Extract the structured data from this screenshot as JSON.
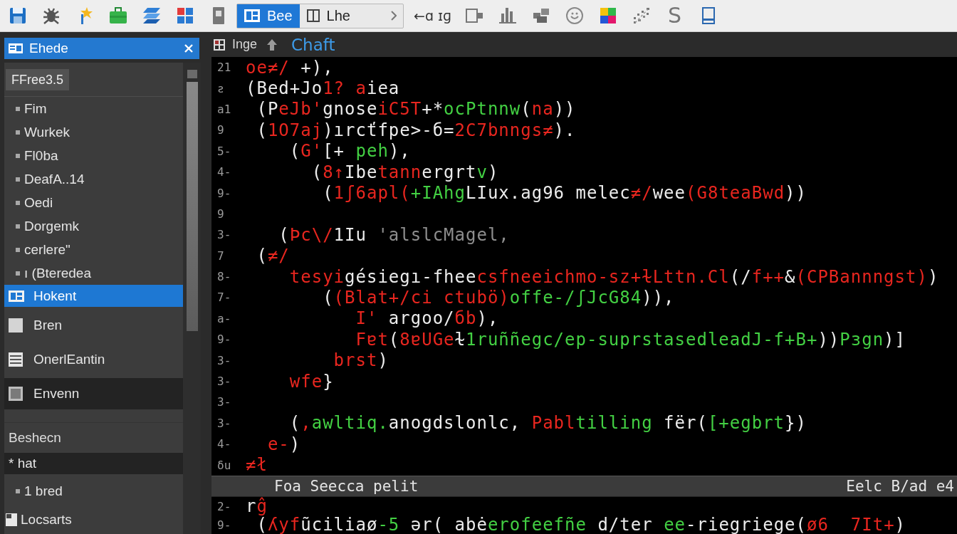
{
  "toolbar": {
    "view_tabs": [
      {
        "label": "Bee",
        "selected": true
      },
      {
        "label": "Lhe",
        "selected": false
      }
    ],
    "nav_button": "←ɑ ɪɡ",
    "letter_button": "S"
  },
  "sidebar": {
    "title": "Ehede",
    "chip": "FFree3.5",
    "items": [
      {
        "kind": "bullet",
        "label": "Fim",
        "selected": false,
        "highlighted": false
      },
      {
        "kind": "bullet",
        "label": "Wurkek",
        "selected": false,
        "highlighted": false
      },
      {
        "kind": "bullet",
        "label": "Fl0ba",
        "selected": false,
        "highlighted": false
      },
      {
        "kind": "bullet",
        "label": "DeafA..14",
        "selected": false,
        "highlighted": false
      },
      {
        "kind": "bullet",
        "label": "Oedi",
        "selected": false,
        "highlighted": false
      },
      {
        "kind": "bullet",
        "label": "Dorgemk",
        "selected": false,
        "highlighted": false
      },
      {
        "kind": "bullet",
        "label": "cerlere\"",
        "selected": false,
        "highlighted": false
      },
      {
        "kind": "bullet",
        "label": "ı (Bteredea",
        "selected": false,
        "highlighted": false
      },
      {
        "kind": "tile",
        "label": "Hokent",
        "selected": true,
        "highlighted": false
      },
      {
        "kind": "square",
        "label": "Bren",
        "selected": false,
        "highlighted": false
      },
      {
        "kind": "lines",
        "label": "OnerlEantin",
        "selected": false,
        "highlighted": false
      },
      {
        "kind": "box",
        "label": "Envenn",
        "selected": false,
        "highlighted": true
      }
    ],
    "section": {
      "title": "Beshecn",
      "items": [
        {
          "kind": "text",
          "label": "* hat",
          "selected": false,
          "highlighted": true
        },
        {
          "kind": "bullet",
          "label": "1 bred",
          "selected": false,
          "highlighted": false
        },
        {
          "kind": "doc",
          "label": "Locsarts",
          "selected": false,
          "highlighted": false
        }
      ]
    }
  },
  "editor": {
    "tab": "Inge",
    "title": "Chaft",
    "lines": [
      {
        "number": "21",
        "segments": [
          {
            "kind": "keyword",
            "text": "oe≠/"
          },
          {
            "kind": "plain",
            "text": " +),"
          }
        ]
      },
      {
        "number": "ƨ",
        "segments": [
          {
            "kind": "plain",
            "text": "(Bed+Jo"
          },
          {
            "kind": "keyword",
            "text": "1?"
          },
          {
            "kind": "keyword",
            "text": " a"
          },
          {
            "kind": "plain",
            "text": "iea"
          }
        ]
      },
      {
        "number": "a1",
        "segments": [
          {
            "kind": "plain",
            "text": " (P"
          },
          {
            "kind": "keyword",
            "text": "eJb'"
          },
          {
            "kind": "plain",
            "text": "gnose"
          },
          {
            "kind": "keyword",
            "text": "iC5T"
          },
          {
            "kind": "plain",
            "text": "+*"
          },
          {
            "kind": "string",
            "text": "ocPtnnw"
          },
          {
            "kind": "plain",
            "text": "("
          },
          {
            "kind": "keyword",
            "text": "na"
          },
          {
            "kind": "plain",
            "text": "))"
          }
        ]
      },
      {
        "number": "9",
        "segments": [
          {
            "kind": "plain",
            "text": " ("
          },
          {
            "kind": "keyword",
            "text": "1O7aj"
          },
          {
            "kind": "plain",
            "text": ")ırcťfpe>-б="
          },
          {
            "kind": "keyword",
            "text": "2C7bnngs≠"
          },
          {
            "kind": "plain",
            "text": ")."
          }
        ]
      },
      {
        "number": "5-",
        "segments": [
          {
            "kind": "plain",
            "text": "    ("
          },
          {
            "kind": "keyword",
            "text": "G'"
          },
          {
            "kind": "plain",
            "text": "[+ "
          },
          {
            "kind": "string",
            "text": "peh"
          },
          {
            "kind": "plain",
            "text": "),"
          }
        ]
      },
      {
        "number": "4-",
        "segments": [
          {
            "kind": "plain",
            "text": "      ("
          },
          {
            "kind": "keyword",
            "text": "8↑"
          },
          {
            "kind": "plain",
            "text": "Ibe"
          },
          {
            "kind": "keyword",
            "text": "tann"
          },
          {
            "kind": "plain",
            "text": "ergrt"
          },
          {
            "kind": "string",
            "text": "v"
          },
          {
            "kind": "plain",
            "text": ")"
          }
        ]
      },
      {
        "number": "9-",
        "segments": [
          {
            "kind": "plain",
            "text": "       ("
          },
          {
            "kind": "keyword",
            "text": "1ʃ6apl("
          },
          {
            "kind": "string",
            "text": "+IAhg"
          },
          {
            "kind": "plain",
            "text": "LIux.ag96 melec"
          },
          {
            "kind": "keyword",
            "text": "≠/"
          },
          {
            "kind": "plain",
            "text": "wee"
          },
          {
            "kind": "keyword",
            "text": "(G8teaBwd"
          },
          {
            "kind": "plain",
            "text": "))"
          }
        ]
      },
      {
        "number": "9"
      },
      {
        "number": "3-",
        "segments": [
          {
            "kind": "plain",
            "text": "   ("
          },
          {
            "kind": "keyword",
            "text": "Þc\\/"
          },
          {
            "kind": "plain",
            "text": "1Iu "
          },
          {
            "kind": "comment",
            "text": "'alslcMagel,"
          }
        ]
      },
      {
        "number": "7",
        "segments": [
          {
            "kind": "plain",
            "text": " ("
          },
          {
            "kind": "keyword",
            "text": "≠/"
          }
        ]
      },
      {
        "number": "8-",
        "segments": [
          {
            "kind": "keyword",
            "text": "    tesyi"
          },
          {
            "kind": "plain",
            "text": "gésiegı-fhee"
          },
          {
            "kind": "keyword",
            "text": "csfneeichmo-sz+ɫLttn.Cl"
          },
          {
            "kind": "plain",
            "text": "(/"
          },
          {
            "kind": "keyword",
            "text": "f++"
          },
          {
            "kind": "plain",
            "text": "&"
          },
          {
            "kind": "keyword",
            "text": "(CPBannngst)"
          },
          {
            "kind": "plain",
            "text": ")"
          }
        ]
      },
      {
        "number": "7-",
        "segments": [
          {
            "kind": "plain",
            "text": "       ("
          },
          {
            "kind": "keyword",
            "text": "(Blat+/ci ctubö)"
          },
          {
            "kind": "string",
            "text": "offe-/ʃJcG84"
          },
          {
            "kind": "plain",
            "text": ")),"
          }
        ]
      },
      {
        "number": "a-",
        "segments": [
          {
            "kind": "keyword",
            "text": "          I'"
          },
          {
            "kind": "plain",
            "text": " argoo/"
          },
          {
            "kind": "keyword",
            "text": "бb"
          },
          {
            "kind": "plain",
            "text": "),"
          }
        ]
      },
      {
        "number": "9-",
        "segments": [
          {
            "kind": "keyword",
            "text": "          Fɐt"
          },
          {
            "kind": "plain",
            "text": "("
          },
          {
            "kind": "keyword",
            "text": "8ɐUGe"
          },
          {
            "kind": "plain",
            "text": "ɫ"
          },
          {
            "kind": "string",
            "text": "1ruññegc/ep-suprstasedleadJ-f+B+"
          },
          {
            "kind": "plain",
            "text": "))"
          },
          {
            "kind": "string",
            "text": "Pзgn"
          },
          {
            "kind": "plain",
            "text": ")]"
          }
        ]
      },
      {
        "number": "3-",
        "segments": [
          {
            "kind": "keyword",
            "text": "        brst"
          },
          {
            "kind": "plain",
            "text": ")"
          }
        ]
      },
      {
        "number": "3-",
        "segments": [
          {
            "kind": "keyword",
            "text": "    wfe"
          },
          {
            "kind": "plain",
            "text": "}"
          }
        ]
      },
      {
        "number": "3-"
      },
      {
        "number": "3-",
        "segments": [
          {
            "kind": "plain",
            "text": "    ("
          },
          {
            "kind": "keyword",
            "text": ","
          },
          {
            "kind": "string",
            "text": "awltiq."
          },
          {
            "kind": "plain",
            "text": "anogdslonlc, "
          },
          {
            "kind": "keyword",
            "text": "Pabl"
          },
          {
            "kind": "string",
            "text": "tilling"
          },
          {
            "kind": "plain",
            "text": " fër("
          },
          {
            "kind": "string",
            "text": "[+egbrt"
          },
          {
            "kind": "plain",
            "text": "})"
          }
        ]
      },
      {
        "number": "4-",
        "segments": [
          {
            "kind": "keyword",
            "text": "  e-"
          },
          {
            "kind": "plain",
            "text": ")"
          }
        ]
      },
      {
        "number": "δu",
        "segments": [
          {
            "kind": "keyword",
            "text": "≠ł"
          }
        ]
      }
    ],
    "find_bar": {
      "label": "Foa Seecca pelit",
      "status": "Eelc B/ad e4"
    },
    "lower_lines": [
      {
        "number": "2-",
        "segments": [
          {
            "kind": "plain",
            "text": "r"
          },
          {
            "kind": "keyword",
            "text": "ĝ"
          }
        ]
      },
      {
        "number": "9-",
        "segments": [
          {
            "kind": "plain",
            "text": " ("
          },
          {
            "kind": "keyword",
            "text": "ʎyf"
          },
          {
            "kind": "plain",
            "text": "ũciliaø"
          },
          {
            "kind": "string",
            "text": "-5"
          },
          {
            "kind": "plain",
            "text": " ǝr( abė"
          },
          {
            "kind": "string",
            "text": "erofeefñe"
          },
          {
            "kind": "plain",
            "text": " d/ter "
          },
          {
            "kind": "string",
            "text": "ee"
          },
          {
            "kind": "plain",
            "text": "-riegriege("
          },
          {
            "kind": "keyword",
            "text": "ø6  7It+"
          },
          {
            "kind": "plain",
            "text": ")"
          }
        ]
      }
    ]
  }
}
